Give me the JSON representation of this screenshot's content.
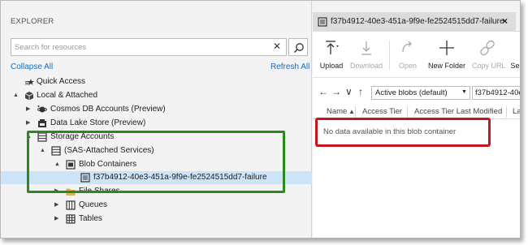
{
  "explorer": {
    "title": "EXPLORER",
    "search_placeholder": "Search for resources",
    "collapse_all": "Collapse All",
    "refresh_all": "Refresh All"
  },
  "tree": [
    {
      "label": "Quick Access",
      "arrow": "",
      "icon": "quick-access-icon"
    },
    {
      "label": "Local & Attached",
      "arrow": "▲",
      "icon": "cube-icon"
    },
    {
      "label": "Cosmos DB Accounts (Preview)",
      "arrow": "▶",
      "icon": "cosmos-db-icon"
    },
    {
      "label": "Data Lake Store (Preview)",
      "arrow": "▶",
      "icon": "data-lake-icon"
    },
    {
      "label": "Storage Accounts",
      "arrow": "▲",
      "icon": "storage-icon"
    },
    {
      "label": "(SAS-Attached Services)",
      "arrow": "▲",
      "icon": "storage-icon"
    },
    {
      "label": "Blob Containers",
      "arrow": "▲",
      "icon": "blob-containers-icon"
    },
    {
      "label": "f37b4912-40e3-451a-9f9e-fe2524515dd7-failure",
      "arrow": "",
      "icon": "container-icon"
    },
    {
      "label": "File Shares",
      "arrow": "▶",
      "icon": "folder-icon"
    },
    {
      "label": "Queues",
      "arrow": "▶",
      "icon": "queue-icon"
    },
    {
      "label": "Tables",
      "arrow": "▶",
      "icon": "table-icon"
    }
  ],
  "tab": {
    "title": "f37b4912-40e3-451a-9f9e-fe2524515dd7-failure",
    "close": "×"
  },
  "toolbar": {
    "upload": "Upload",
    "download": "Download",
    "open": "Open",
    "new_folder": "New Folder",
    "copy_url": "Copy URL",
    "select": "Se"
  },
  "nav": {
    "back": "←",
    "forward": "→",
    "down": "∨",
    "up": "↑",
    "view_select": "Active blobs (default)",
    "path": "f37b4912-40e"
  },
  "columns": [
    "Name",
    "Access Tier",
    "Access Tier Last Modified",
    "La"
  ],
  "empty_message": "No data available in this blob container",
  "colors": {
    "green_highlight": "#2a8a1e",
    "red_highlight": "#c8141d",
    "link": "#1a6cc4",
    "selection": "#cde3f7"
  }
}
